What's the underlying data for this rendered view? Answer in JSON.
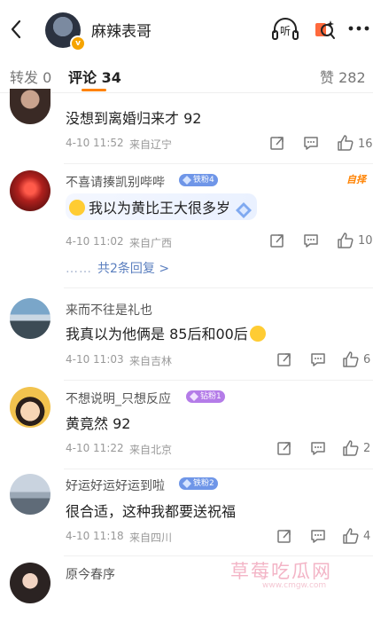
{
  "header": {
    "back_icon": "chevron-left-icon",
    "title": "麻辣表哥",
    "listen_label": "听",
    "verified_badge": "v"
  },
  "tabs": {
    "repost": "转发 0",
    "comment": "评论 34",
    "like": "赞 282"
  },
  "top_flag": "自择",
  "comments": [
    {
      "text": "没想到离婚归来才 92",
      "date": "4-10 11:52",
      "location": "来自辽宁",
      "likes": "16"
    },
    {
      "username": "不喜请揍凯别哔哔",
      "fan_badge": "铁粉4",
      "text": "我以为黄比王大很多岁",
      "date": "4-10 11:02",
      "location": "来自广西",
      "likes": "10",
      "replies_label": "共2条回复 >",
      "replies_dots": "……"
    },
    {
      "username": "来而不往是礼也",
      "text": "我真以为他俩是 85后和00后",
      "date": "4-10 11:03",
      "location": "来自吉林",
      "likes": "6"
    },
    {
      "username": "不想说明_只想反应",
      "fan_badge": "钻粉1",
      "text": "黄竟然 92",
      "date": "4-10 11:22",
      "location": "来自北京",
      "likes": "2"
    },
    {
      "username": "好运好运好运到啦",
      "fan_badge": "铁粉2",
      "text": "很合适，这种我都要送祝福",
      "date": "4-10 11:18",
      "location": "来自四川",
      "likes": "4"
    },
    {
      "username": "原今春序"
    }
  ],
  "watermark": {
    "title": "草莓吃瓜网",
    "sub": "www.cmgw.com"
  },
  "colors": {
    "accent": "#ff8200",
    "link": "#5b7fbf",
    "iron_fan": "#6f96e8",
    "diamond_fan": "#b47ce8"
  }
}
